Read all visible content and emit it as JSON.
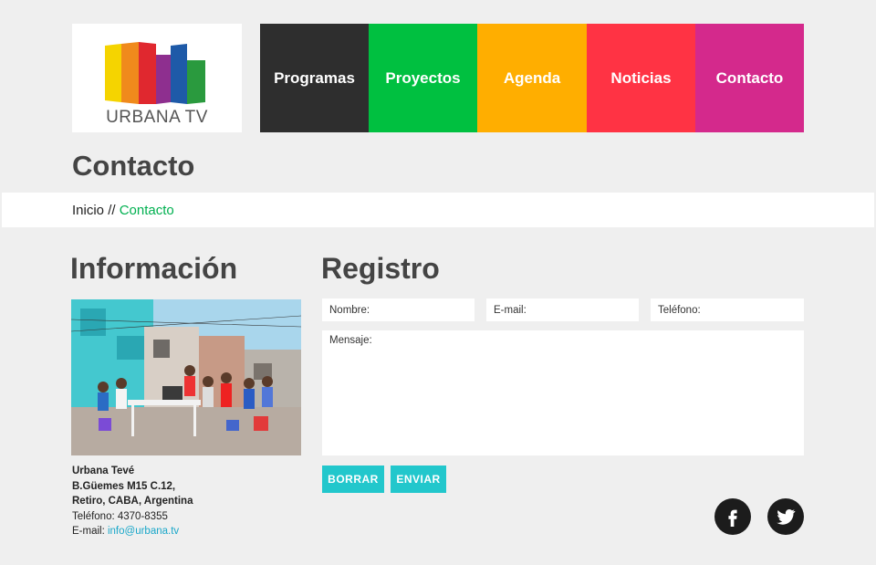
{
  "logo": {
    "text": "URBANA TV",
    "colors": [
      "#f5d400",
      "#f08a1c",
      "#e0282f",
      "#8e2f8f",
      "#1e5aa8",
      "#2a9a3e"
    ]
  },
  "nav": {
    "items": [
      {
        "label": "Programas",
        "color": "#2e2e2e"
      },
      {
        "label": "Proyectos",
        "color": "#00c040"
      },
      {
        "label": "Agenda",
        "color": "#ffae00"
      },
      {
        "label": "Noticias",
        "color": "#ff3344"
      },
      {
        "label": "Contacto",
        "color": "#d4298c"
      }
    ]
  },
  "page": {
    "title": "Contacto"
  },
  "breadcrumb": {
    "home": "Inicio",
    "separator": " // ",
    "current": "Contacto"
  },
  "info": {
    "title": "Información",
    "name": "Urbana Tevé",
    "address1": "B.Güemes M15 C.12,",
    "address2": "Retiro, CABA, Argentina",
    "phone": "Teléfono: 4370-8355",
    "email_label": "E-mail: ",
    "email": "info@urbana.tv"
  },
  "form": {
    "title": "Registro",
    "name_placeholder": "Nombre:",
    "email_placeholder": "E-mail:",
    "phone_placeholder": "Teléfono:",
    "message_placeholder": "Mensaje:",
    "reset_label": "BORRAR",
    "submit_label": "ENVIAR"
  },
  "social": {
    "icons": [
      "facebook-icon",
      "twitter-icon"
    ]
  }
}
